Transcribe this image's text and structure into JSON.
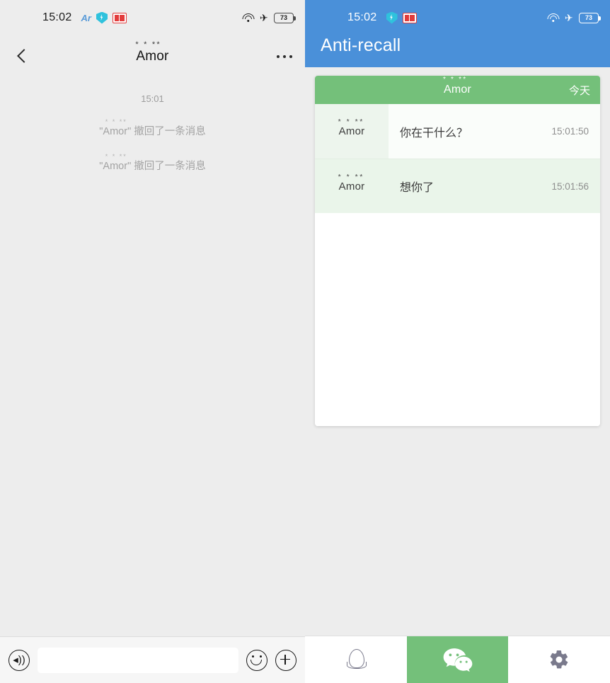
{
  "colors": {
    "wechat_bg": "#ededed",
    "app_header_blue": "#4a90d9",
    "card_green": "#74c07a",
    "row_highlight": "#eaf5ea",
    "highlight_red": "#d52231",
    "gear_gray": "#7a7a8c"
  },
  "left_panel": {
    "status_bar": {
      "time": "15:02",
      "icons_left": [
        "ar-icon",
        "shield-icon",
        "red-badge-icon"
      ],
      "ar_label": "Ar",
      "icons_right": [
        "wifi-icon",
        "airplane-mode-icon",
        "battery-icon"
      ],
      "battery_level": "73"
    },
    "nav": {
      "back_icon": "chevron-left-icon",
      "title": "Amor",
      "title_stars": "* * **",
      "more_icon": "more-options-icon"
    },
    "chat": {
      "timestamp": "15:01",
      "system_messages": [
        {
          "nick": "Amor",
          "stars": "* * **",
          "text": "撤回了一条消息",
          "quote_open": "\"",
          "quote_close": "\""
        },
        {
          "nick": "Amor",
          "stars": "* * **",
          "text": "撤回了一条消息",
          "quote_open": "\"",
          "quote_close": "\""
        }
      ]
    },
    "input_bar": {
      "voice_icon": "voice-input-icon",
      "voice_glyph": "◂))",
      "input_value": "",
      "input_placeholder": "",
      "emoji_icon": "emoji-icon",
      "plus_icon": "plus-icon"
    }
  },
  "right_panel": {
    "status_bar": {
      "time": "15:02",
      "icons_left": [
        "shield-icon",
        "red-badge-icon"
      ],
      "icons_right": [
        "wifi-icon",
        "airplane-mode-icon",
        "battery-icon"
      ],
      "battery_level": "73"
    },
    "app_title": "Anti-recall",
    "card": {
      "header": {
        "nick": "Amor",
        "stars": "* * **",
        "day_label": "今天"
      },
      "columns": [
        "sender",
        "message",
        "time"
      ],
      "messages": [
        {
          "nick": "Amor",
          "stars": "* * **",
          "text": "你在干什么？",
          "time": "15:01:50"
        },
        {
          "nick": "Amor",
          "stars": "* * **",
          "text": "想你了",
          "time": "15:01:56"
        }
      ]
    },
    "bottom_nav": {
      "items": [
        {
          "name": "qq",
          "icon": "qq-penguin-icon",
          "active": false
        },
        {
          "name": "wechat",
          "icon": "wechat-icon",
          "active": true
        },
        {
          "name": "settings",
          "icon": "gear-icon",
          "active": false
        }
      ],
      "highlight_target": "wechat"
    }
  }
}
